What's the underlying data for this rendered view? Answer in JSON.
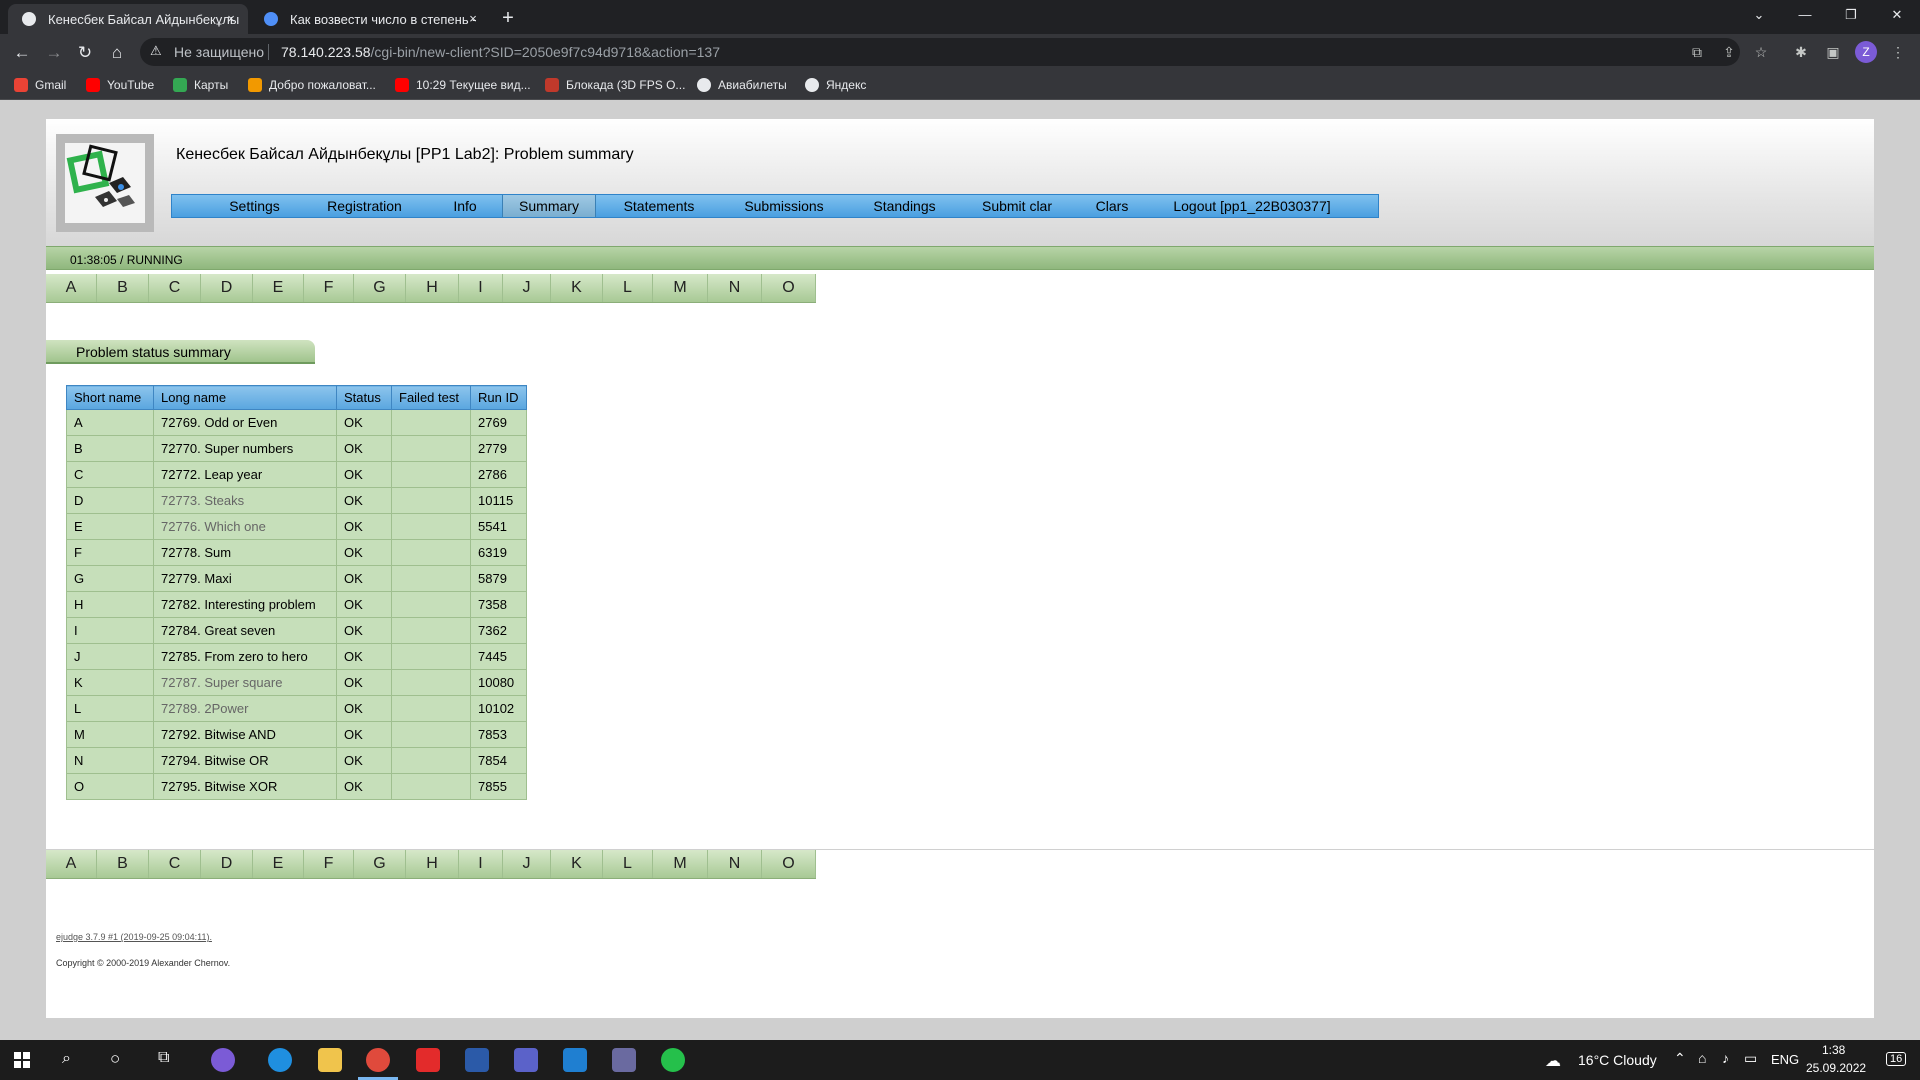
{
  "browser": {
    "tabs": [
      {
        "title": "Кенесбек Байсал Айдынбекұлы",
        "close": "×"
      },
      {
        "title": "Как возвести число в степень -",
        "close": "×"
      }
    ],
    "new_tab": "+",
    "window_controls": {
      "minimize": "—",
      "restore": "❐",
      "close": "✕"
    },
    "address": {
      "warning": "⚠",
      "security_text": "Не защищено",
      "host": "78.140.223.58",
      "path": "/cgi-bin/new-client?SID=2050e9f7c94d9718&action=137"
    },
    "profile_initial": "Z",
    "bookmarks": [
      {
        "label": "Gmail",
        "color": "#ea4335"
      },
      {
        "label": "YouTube",
        "color": "#ff0000"
      },
      {
        "label": "Карты",
        "color": "#34a853"
      },
      {
        "label": "Добро пожаловат...",
        "color": "#f29900"
      },
      {
        "label": "10:29 Текущее вид...",
        "color": "#ff0000"
      },
      {
        "label": "Блокада (3D FPS O...",
        "color": "#c0392b"
      },
      {
        "label": "Авиабилеты",
        "color": "#e8eaed"
      },
      {
        "label": "Яндекс",
        "color": "#e8eaed"
      }
    ]
  },
  "page": {
    "title": "Кенесбек Байсал Айдынбекұлы [PP1 Lab2]: Problem summary",
    "menu": [
      "Settings",
      "Registration",
      "Info",
      "Summary",
      "Statements",
      "Submissions",
      "Standings",
      "Submit clar",
      "Clars",
      "Logout [pp1_22B030377]"
    ],
    "menu_active": "Summary",
    "status": "01:38:05 / RUNNING",
    "problems": [
      "A",
      "B",
      "C",
      "D",
      "E",
      "F",
      "G",
      "H",
      "I",
      "J",
      "K",
      "L",
      "M",
      "N",
      "O"
    ],
    "section_title": "Problem status summary",
    "table": {
      "headers": [
        "Short name",
        "Long name",
        "Status",
        "Failed test",
        "Run ID"
      ],
      "rows": [
        {
          "short": "A",
          "long": "72769. Odd or Even",
          "status": "OK",
          "failed": "",
          "run": "2769"
        },
        {
          "short": "B",
          "long": "72770. Super numbers",
          "status": "OK",
          "failed": "",
          "run": "2779"
        },
        {
          "short": "C",
          "long": "72772. Leap year",
          "status": "OK",
          "failed": "",
          "run": "2786"
        },
        {
          "short": "D",
          "long": "72773. Steaks",
          "status": "OK",
          "failed": "",
          "run": "10115"
        },
        {
          "short": "E",
          "long": "72776. Which one",
          "status": "OK",
          "failed": "",
          "run": "5541"
        },
        {
          "short": "F",
          "long": "72778. Sum",
          "status": "OK",
          "failed": "",
          "run": "6319"
        },
        {
          "short": "G",
          "long": "72779. Maxi",
          "status": "OK",
          "failed": "",
          "run": "5879"
        },
        {
          "short": "H",
          "long": "72782. Interesting problem",
          "status": "OK",
          "failed": "",
          "run": "7358"
        },
        {
          "short": "I",
          "long": "72784. Great seven",
          "status": "OK",
          "failed": "",
          "run": "7362"
        },
        {
          "short": "J",
          "long": "72785. From zero to hero",
          "status": "OK",
          "failed": "",
          "run": "7445"
        },
        {
          "short": "K",
          "long": "72787. Super square",
          "status": "OK",
          "failed": "",
          "run": "10080"
        },
        {
          "short": "L",
          "long": "72789. 2Power",
          "status": "OK",
          "failed": "",
          "run": "10102"
        },
        {
          "short": "M",
          "long": "72792. Bitwise AND",
          "status": "OK",
          "failed": "",
          "run": "7853"
        },
        {
          "short": "N",
          "long": "72794. Bitwise OR",
          "status": "OK",
          "failed": "",
          "run": "7854"
        },
        {
          "short": "O",
          "long": "72795. Bitwise XOR",
          "status": "OK",
          "failed": "",
          "run": "7855"
        }
      ]
    },
    "footer_version": "ejudge 3.7.9 #1 (2019-09-25 09:04:11).",
    "footer_copyright": "Copyright © 2000-2019 Alexander Chernov."
  },
  "taskbar": {
    "weather": "16°C  Cloudy",
    "lang": "ENG",
    "time": "1:38",
    "date": "25.09.2022",
    "notif_count": "16"
  }
}
